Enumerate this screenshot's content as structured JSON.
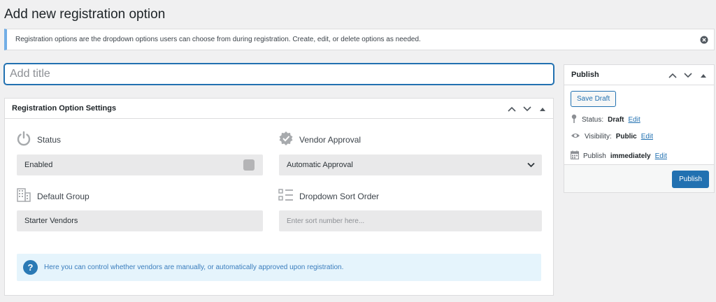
{
  "page": {
    "title": "Add new registration option"
  },
  "notice": {
    "text": "Registration options are the dropdown options users can choose from during registration. Create, edit, or delete options as needed."
  },
  "title_field": {
    "placeholder": "Add title",
    "value": ""
  },
  "settings": {
    "heading": "Registration Option Settings",
    "status": {
      "label": "Status",
      "value": "Enabled",
      "icon": "power-icon"
    },
    "vendor_approval": {
      "label": "Vendor Approval",
      "value": "Automatic Approval",
      "icon": "verified-badge-icon"
    },
    "default_group": {
      "label": "Default Group",
      "value": "Starter Vendors",
      "icon": "building-icon"
    },
    "sort_order": {
      "label": "Dropdown Sort Order",
      "placeholder": "Enter sort number here...",
      "value": "",
      "icon": "sort-list-icon"
    },
    "info": "Here you can control whether vendors are manually, or automatically approved upon registration."
  },
  "publish": {
    "heading": "Publish",
    "save_draft": "Save Draft",
    "status_label": "Status:",
    "status_value": "Draft",
    "visibility_label": "Visibility:",
    "visibility_value": "Public",
    "publish_label": "Publish",
    "publish_value": "immediately",
    "edit": "Edit",
    "button": "Publish"
  },
  "colors": {
    "accent": "#2271b1",
    "notice_border": "#72aee6",
    "info_bg": "#e5f4fc",
    "info_icon": "#2b7ab5"
  }
}
